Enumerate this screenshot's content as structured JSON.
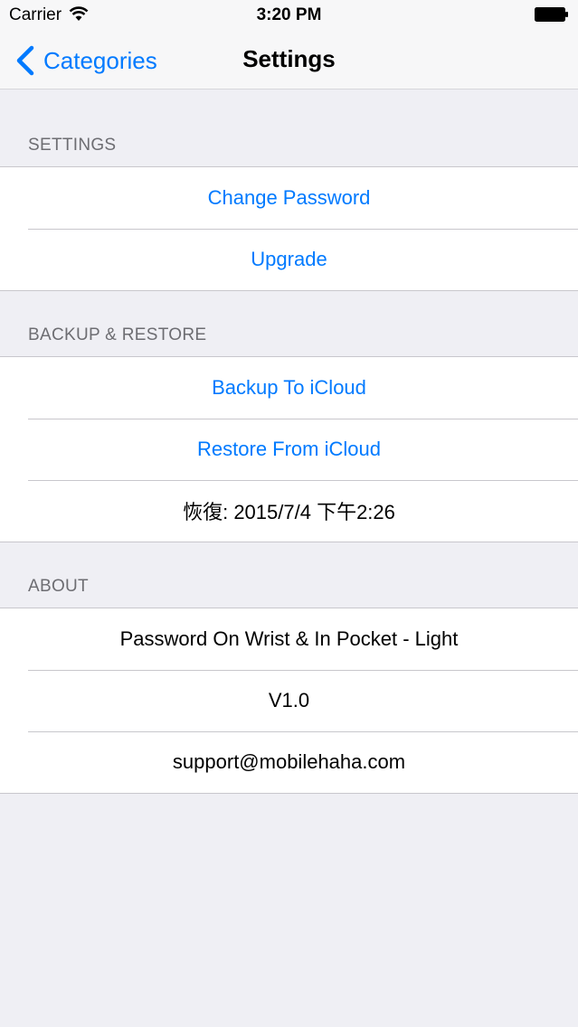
{
  "status_bar": {
    "carrier": "Carrier",
    "time": "3:20 PM",
    "wifi_icon": "wifi-icon",
    "battery_icon": "battery-icon"
  },
  "nav_bar": {
    "back_label": "Categories",
    "title": "Settings"
  },
  "colors": {
    "accent": "#007aff",
    "background": "#efeff4",
    "header_text": "#6d6d72"
  },
  "sections": [
    {
      "header": "SETTINGS",
      "items": [
        {
          "label": "Change Password"
        },
        {
          "label": "Upgrade"
        }
      ]
    },
    {
      "header": "BACKUP & RESTORE",
      "items": [
        {
          "label": "Backup To iCloud"
        },
        {
          "label": "Restore From iCloud"
        },
        {
          "label": "恢復: 2015/7/4 下午2:26"
        }
      ]
    },
    {
      "header": "ABOUT",
      "items": [
        {
          "label": "Password On Wrist & In Pocket - Light"
        },
        {
          "label": "V1.0"
        },
        {
          "label": "support@mobilehaha.com"
        }
      ]
    }
  ]
}
